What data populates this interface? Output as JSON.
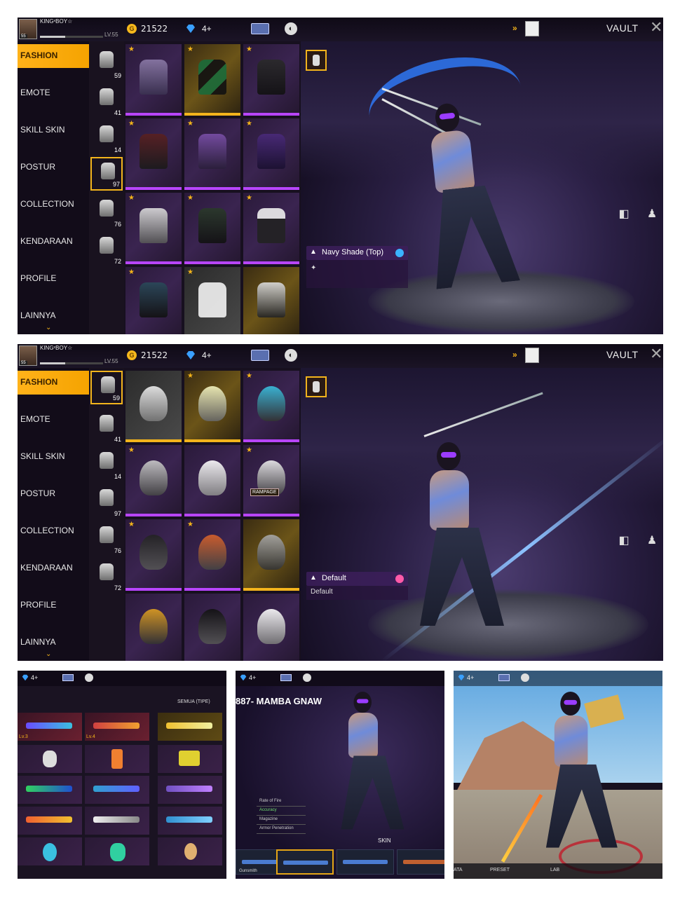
{
  "player": {
    "name": "KINGˣBOY☆",
    "level": "LV.55",
    "avatar_level": "55"
  },
  "currency": {
    "coins": "21522",
    "diamonds": "4+"
  },
  "header": {
    "title": "VAULT"
  },
  "menu": [
    {
      "label": "FASHION",
      "active": true
    },
    {
      "label": "EMOTE"
    },
    {
      "label": "SKILL SKIN"
    },
    {
      "label": "POSTUR"
    },
    {
      "label": "COLLECTION"
    },
    {
      "label": "KENDARAAN"
    },
    {
      "label": "PROFILE"
    },
    {
      "label": "LAINNYA"
    }
  ],
  "subcategories": [
    {
      "icon": "hat-icon",
      "count": "59"
    },
    {
      "icon": "mask-icon",
      "count": "41"
    },
    {
      "icon": "head-icon",
      "count": "14"
    },
    {
      "icon": "top-icon",
      "count": "97"
    },
    {
      "icon": "pants-icon",
      "count": "76"
    },
    {
      "icon": "feet-icon",
      "count": "72"
    }
  ],
  "panel_top": {
    "selected_subcategory": 3,
    "selected_item_name": "Navy Shade (Top)"
  },
  "panel_mid": {
    "selected_subcategory": 0,
    "selected_item_name": "Default",
    "selected_item_sub": "Default"
  },
  "panel_b1": {
    "diamonds": "4+",
    "filter_label": "SEMUA (TIPE)",
    "cell_labels": [
      "Lv.3",
      "Lv.4"
    ]
  },
  "panel_b2": {
    "diamonds": "4+",
    "weapon_name": "887- MAMBA GNAW",
    "stats": [
      "Rate of Fire",
      "Accuracy",
      "Magazine",
      "Armor Penetration"
    ],
    "skin_label": "SKIN",
    "slot_label": "Gunsmith"
  },
  "panel_b3": {
    "diamonds": "4+",
    "bottom_labels": [
      "ATA",
      "PRESET",
      "LAB"
    ]
  },
  "colors": {
    "accent": "#f4b41a",
    "rarity_purple": "#b845ff",
    "menu_bg": "#120c19"
  }
}
